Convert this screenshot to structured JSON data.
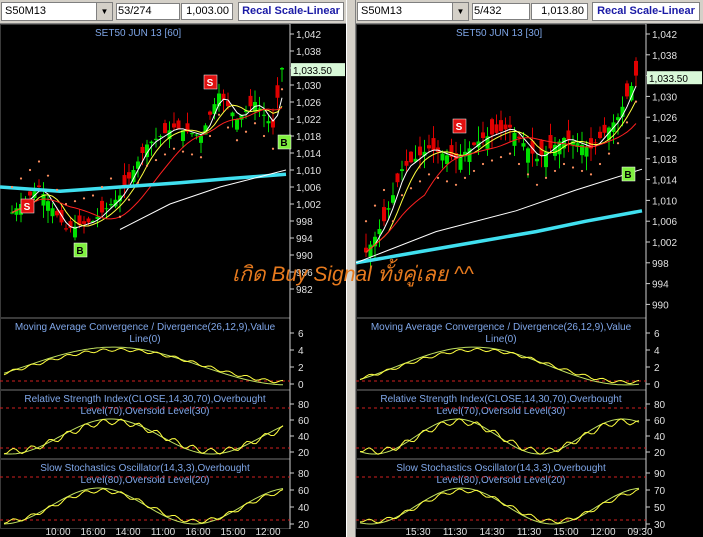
{
  "colors": {
    "up_candle": "#00e000",
    "down_candle": "#e00000",
    "ma_fast": "#ffffff",
    "ma_mid": "#ffff40",
    "ma_slow": "#ff2020",
    "ma_long": "#40e0f0",
    "sar_dots": "#ff9060",
    "indicator_line": "#ffff40",
    "indicator_line2": "#c0e060",
    "overbought_line": "#d02020",
    "panel_title": "#7fa6e8",
    "price_marker_bg": "#d8f8d8",
    "overlay_text": "#e77a1e"
  },
  "overlay_text": "เกิด Buy Signal ทั้งคู่เลย ^^",
  "charts": [
    {
      "symbol": "S50M13",
      "bars_info": "53/274",
      "last_price": "1,003.00",
      "scale_button": "Recal Scale-Linear",
      "title": "SET50 JUN 13   [60]",
      "price_marker": "1,033.50",
      "price_ticks": [
        "1,042",
        "1,038",
        "1,034",
        "1,030",
        "1,026",
        "1,022",
        "1,018",
        "1,014",
        "1,010",
        "1,006",
        "1,002",
        "998",
        "994",
        "990",
        "986",
        "982"
      ],
      "signals": [
        {
          "label": "S",
          "type": "sell"
        },
        {
          "label": "B",
          "type": "buy"
        },
        {
          "label": "S",
          "type": "sell"
        },
        {
          "label": "B",
          "type": "buy"
        }
      ],
      "macd": {
        "title_1": "Moving Average Convergence / Divergence(26,12,9),Value",
        "title_2": "Line(0)",
        "ticks": [
          "6",
          "4",
          "2",
          "0"
        ]
      },
      "rsi": {
        "title_1": "Relative Strength Index(CLOSE,14,30,70),Overbought",
        "title_2": "Level(70),Oversold Level(30)",
        "ticks": [
          "80",
          "60",
          "40",
          "20"
        ]
      },
      "stoch": {
        "title_1": "Slow Stochastics Oscillator(14,3,3),Overbought",
        "title_2": "Level(80),Oversold Level(20)",
        "ticks": [
          "80",
          "60",
          "40",
          "20"
        ]
      },
      "time_ticks": [
        "10:00",
        "16:00",
        "14:00",
        "11:00",
        "16:00",
        "15:00",
        "12:00"
      ]
    },
    {
      "symbol": "S50M13",
      "bars_info": "5/432",
      "last_price": "1,013.80",
      "scale_button": "Recal Scale-Linear",
      "title": "SET50 JUN 13   [30]",
      "price_marker": "1,033.50",
      "price_ticks": [
        "1,042",
        "1,038",
        "1,034",
        "1,030",
        "1,026",
        "1,022",
        "1,018",
        "1,014",
        "1,010",
        "1,006",
        "1,002",
        "998",
        "994",
        "990"
      ],
      "signals": [
        {
          "label": "S",
          "type": "sell"
        },
        {
          "label": "B",
          "type": "buy"
        }
      ],
      "macd": {
        "title_1": "Moving Average Convergence / Divergence(26,12,9),Value",
        "title_2": "Line(0)",
        "ticks": [
          "6",
          "4",
          "2",
          "0"
        ]
      },
      "rsi": {
        "title_1": "Relative Strength Index(CLOSE,14,30,70),Overbought",
        "title_2": "Level(70),Oversold Level(30)",
        "ticks": [
          "80",
          "60",
          "40",
          "20"
        ]
      },
      "stoch": {
        "title_1": "Slow Stochastics Oscillator(14,3,3),Overbought",
        "title_2": "Level(80),Oversold Level(20)",
        "ticks": [
          "90",
          "70",
          "50",
          "30"
        ]
      },
      "time_ticks": [
        "15:30",
        "11:30",
        "14:30",
        "11:30",
        "15:00",
        "12:00",
        "09:30"
      ]
    }
  ]
}
